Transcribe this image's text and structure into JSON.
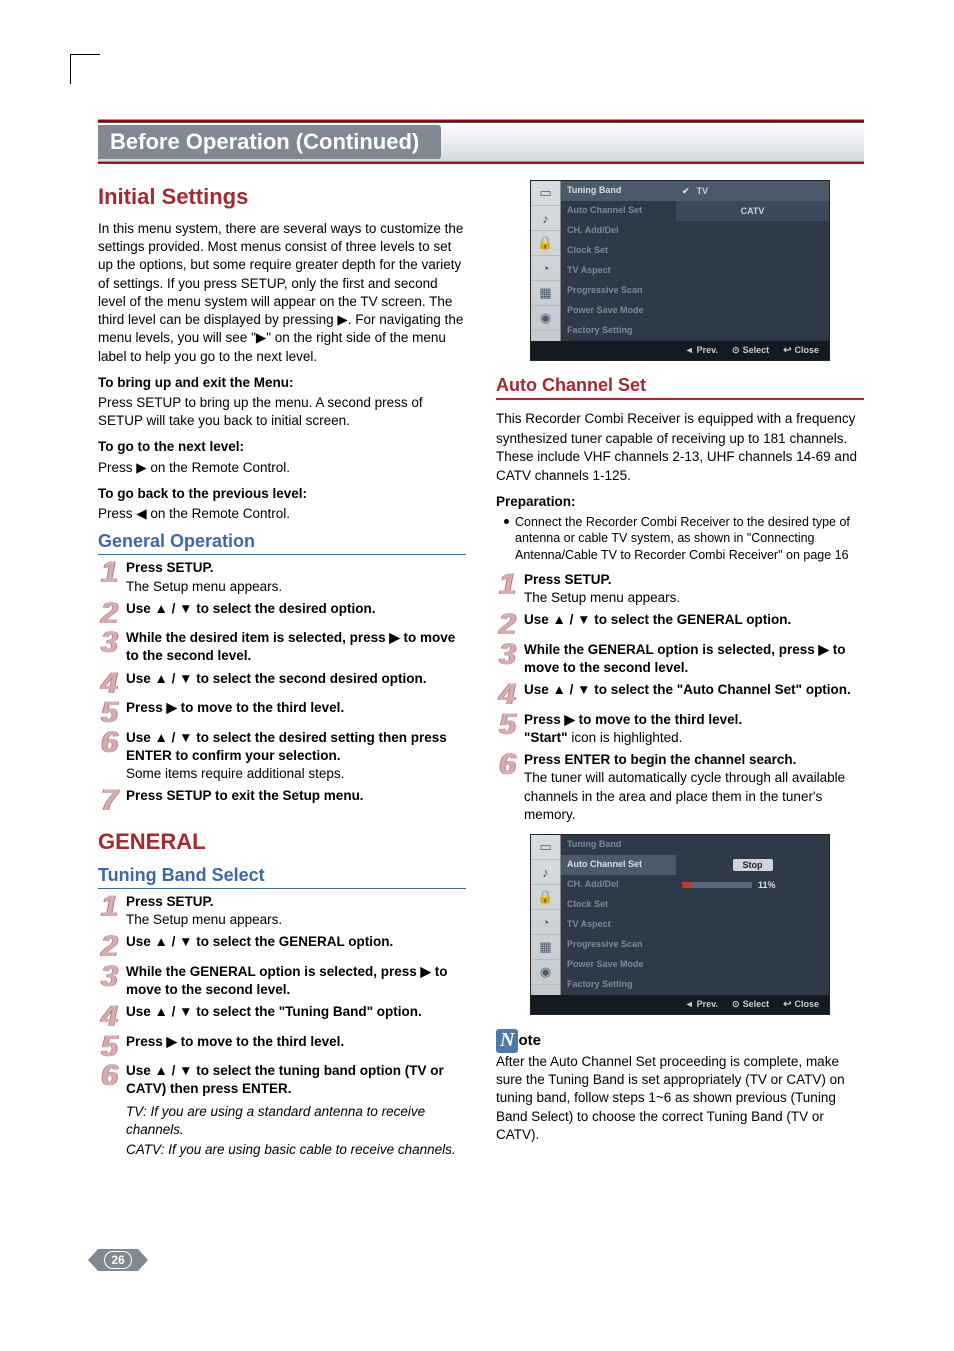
{
  "page_number": "26",
  "header": {
    "title": "Before Operation (Continued)"
  },
  "left": {
    "h1": "Initial Settings",
    "intro": "In this menu system, there are several ways to customize the settings provided. Most menus consist of three levels to set up the options, but some require greater depth for the variety of settings. If you press SETUP, only the first and second level of the menu system will appear on the TV screen. The third level can be displayed by pressing ▶. For navigating the menu levels, you will see \"▶\" on the right side of the menu label to help you go to the next level.",
    "b1_title": "To bring up and exit the Menu:",
    "b1_body": "Press SETUP to bring up the menu. A second press of SETUP will take you back to initial screen.",
    "b2_title": "To go to the next level:",
    "b2_body": "Press ▶ on the Remote Control.",
    "b3_title": "To go back to the previous level:",
    "b3_body": "Press ◀ on the Remote Control.",
    "gen_ops_h": "General Operation",
    "gen_steps": [
      {
        "n": "1",
        "bold": "Press SETUP.",
        "sub": "The Setup menu appears."
      },
      {
        "n": "2",
        "bold": "Use ▲ / ▼ to select the desired option.",
        "sub": ""
      },
      {
        "n": "3",
        "bold": "While the desired item is selected, press ▶ to move to the second level.",
        "sub": ""
      },
      {
        "n": "4",
        "bold": "Use ▲ / ▼ to select the second desired option.",
        "sub": ""
      },
      {
        "n": "5",
        "bold": "Press ▶ to move to the third level.",
        "sub": ""
      },
      {
        "n": "6",
        "bold": "Use ▲ / ▼ to select the desired setting then press ENTER to confirm your selection.",
        "sub": "Some items require additional steps."
      },
      {
        "n": "7",
        "bold": "Press SETUP to exit the Setup menu.",
        "sub": ""
      }
    ],
    "general_h": "GENERAL",
    "tbs_h": "Tuning Band Select",
    "tbs_steps": [
      {
        "n": "1",
        "bold": "Press SETUP.",
        "sub": "The Setup menu appears."
      },
      {
        "n": "2",
        "bold": "Use ▲ / ▼ to select the GENERAL option.",
        "sub": ""
      },
      {
        "n": "3",
        "bold": "While the GENERAL option is selected, press ▶ to move to the second level.",
        "sub": ""
      },
      {
        "n": "4",
        "bold": "Use ▲ / ▼ to select the \"Tuning Band\" option.",
        "sub": ""
      },
      {
        "n": "5",
        "bold": "Press ▶ to move to the third level.",
        "sub": ""
      },
      {
        "n": "6",
        "bold": "Use ▲ / ▼ to select the tuning band option (TV or CATV) then press ENTER.",
        "sub": ""
      }
    ],
    "tbs_note1": "TV: If you are using a standard antenna to receive channels.",
    "tbs_note2": "CATV: If you are using basic cable to receive channels."
  },
  "right": {
    "menu1": {
      "items": [
        "Tuning Band",
        "Auto Channel Set",
        "CH. Add/Del",
        "Clock Set",
        "TV Aspect",
        "Progressive Scan",
        "Power Save Mode",
        "Factory Setting"
      ],
      "vals": [
        "TV",
        "CATV"
      ],
      "foot_prev": "Prev.",
      "foot_select": "Select",
      "foot_close": "Close"
    },
    "acs_h": "Auto Channel Set",
    "acs_p1": "This Recorder Combi Receiver is equipped with a frequency",
    "acs_p2": "synthesized tuner capable of receiving up to 181 channels. These include VHF channels 2-13, UHF channels 14-69 and CATV channels 1-125.",
    "prep_h": "Preparation:",
    "prep_bullet": "Connect the Recorder Combi Receiver to the desired type of antenna or cable TV system, as shown in \"Connecting Antenna/Cable TV to Recorder Combi Receiver\" on page 16",
    "acs_steps": [
      {
        "n": "1",
        "bold": "Press SETUP.",
        "sub": "The Setup menu appears."
      },
      {
        "n": "2",
        "bold": "Use ▲ / ▼ to select the GENERAL option.",
        "sub": ""
      },
      {
        "n": "3",
        "bold": "While the GENERAL option is selected, press ▶ to move to the second level.",
        "sub": ""
      },
      {
        "n": "4",
        "bold": "Use ▲ / ▼ to select the \"Auto Channel Set\" option.",
        "sub": ""
      },
      {
        "n": "5",
        "bold": "Press ▶ to move to the third level.",
        "sub": "\"Start\" icon is highlighted."
      },
      {
        "n": "6",
        "bold": "Press ENTER to begin the channel search.",
        "sub": "The tuner will automatically cycle through all available channels in the area and place them in the tuner's memory."
      }
    ],
    "menu2": {
      "items": [
        "Tuning Band",
        "Auto Channel Set",
        "CH. Add/Del",
        "Clock Set",
        "TV Aspect",
        "Progressive Scan",
        "Power Save Mode",
        "Factory Setting"
      ],
      "stop": "Stop",
      "pct": "11%"
    },
    "note_glyph": "N",
    "note_rest": "ote",
    "note_body": "After the Auto Channel Set proceeding is complete, make sure the Tuning Band is set appropriately (TV or CATV) on tuning band, follow steps 1~6 as shown previous (Tuning Band Select) to choose the correct Tuning Band (TV or CATV)."
  }
}
